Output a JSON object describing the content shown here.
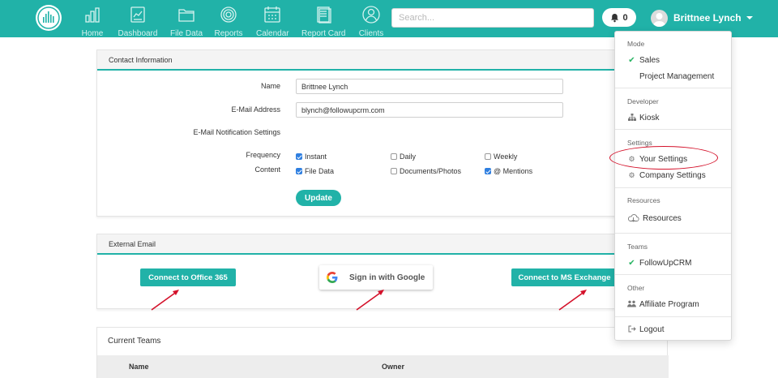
{
  "nav": {
    "items": [
      {
        "label": "Home",
        "icon": "bar-chart-icon"
      },
      {
        "label": "Dashboard",
        "icon": "clipboard-chart-icon"
      },
      {
        "label": "File Data",
        "icon": "folder-icon"
      },
      {
        "label": "Reports",
        "icon": "target-icon"
      },
      {
        "label": "Calendar",
        "icon": "calendar-icon"
      },
      {
        "label": "Report Card",
        "icon": "report-card-icon"
      },
      {
        "label": "Clients",
        "icon": "person-icon"
      }
    ],
    "search_placeholder": "Search...",
    "notification_count": "0",
    "user_name": "Brittnee Lynch"
  },
  "contact": {
    "title": "Contact Information",
    "name_label": "Name",
    "name_value": "Brittnee Lynch",
    "email_label": "E-Mail Address",
    "email_value": "blynch@followupcrm.com",
    "notif_label": "E-Mail Notification Settings",
    "frequency_label": "Frequency",
    "content_label": "Content",
    "frequency_options": [
      {
        "label": "Instant",
        "checked": true
      },
      {
        "label": "Daily",
        "checked": false
      },
      {
        "label": "Weekly",
        "checked": false
      }
    ],
    "content_options": [
      {
        "label": "File Data",
        "checked": true
      },
      {
        "label": "Documents/Photos",
        "checked": false
      },
      {
        "label": "@ Mentions",
        "checked": true
      }
    ],
    "update_label": "Update"
  },
  "external": {
    "title": "External Email",
    "office_label": "Connect to Office 365",
    "google_label": "Sign in with Google",
    "exchange_label": "Connect to MS Exchange"
  },
  "teams": {
    "title": "Current Teams",
    "col_name": "Name",
    "col_owner": "Owner"
  },
  "dropdown": {
    "mode_head": "Mode",
    "sales": "Sales",
    "pm": "Project Management",
    "dev_head": "Developer",
    "kiosk": "Kiosk",
    "settings_head": "Settings",
    "your_settings": "Your Settings",
    "company_settings": "Company Settings",
    "resources_head": "Resources",
    "resources": "Resources",
    "teams_head": "Teams",
    "team_name": "FollowUpCRM",
    "other_head": "Other",
    "affiliate": "Affiliate Program",
    "logout": "Logout"
  },
  "colors": {
    "brand": "#21b2a8",
    "annotation": "#d4112a",
    "check": "#28b463",
    "checkbox": "#2f7fe0"
  }
}
